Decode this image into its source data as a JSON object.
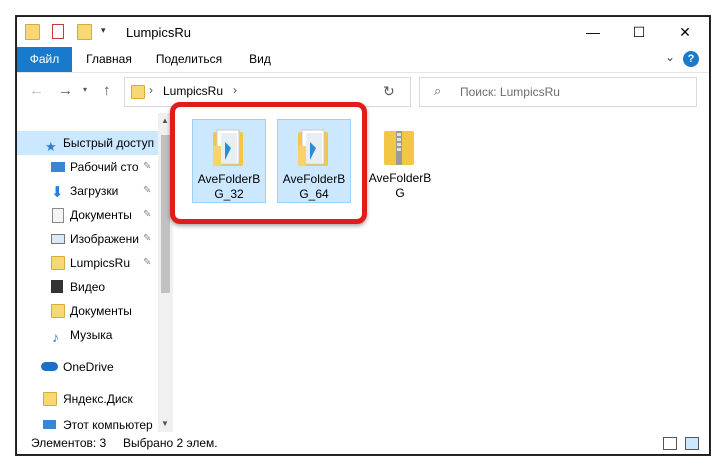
{
  "window": {
    "title": "LumpicsRu",
    "controls": {
      "minimize": "—",
      "maximize": "☐",
      "close": "✕"
    }
  },
  "ribbon": {
    "tabs": [
      "Файл",
      "Главная",
      "Поделиться",
      "Вид"
    ],
    "help": "?"
  },
  "address": {
    "path": "LumpicsRu",
    "search_placeholder": "Поиск: LumpicsRu"
  },
  "sidebar": {
    "items": [
      {
        "label": "Быстрый доступ",
        "icon": "star-icon",
        "pinned": false
      },
      {
        "label": "Рабочий сто",
        "icon": "desktop-icon",
        "pinned": true
      },
      {
        "label": "Загрузки",
        "icon": "download-icon",
        "pinned": true
      },
      {
        "label": "Документы",
        "icon": "documents-icon",
        "pinned": true
      },
      {
        "label": "Изображени",
        "icon": "pictures-icon",
        "pinned": true
      },
      {
        "label": "LumpicsRu",
        "icon": "folder-icon",
        "pinned": true
      },
      {
        "label": "Видео",
        "icon": "video-icon",
        "pinned": false
      },
      {
        "label": "Документы",
        "icon": "folder-icon",
        "pinned": false
      },
      {
        "label": "Музыка",
        "icon": "music-icon",
        "pinned": false
      },
      {
        "label": "OneDrive",
        "icon": "cloud-icon",
        "pinned": false
      },
      {
        "label": "Яндекс.Диск",
        "icon": "yandex-disk-icon",
        "pinned": false
      },
      {
        "label": "Этот компьютер",
        "icon": "computer-icon",
        "pinned": false
      }
    ],
    "pin_glyph": "📌"
  },
  "files": [
    {
      "name": "AveFolderBG_32",
      "line1": "AveFolderB",
      "line2": "G_32",
      "selected": true,
      "type": "folder"
    },
    {
      "name": "AveFolderBG_64",
      "line1": "AveFolderB",
      "line2": "G_64",
      "selected": true,
      "type": "folder"
    },
    {
      "name": "AveFolderBG",
      "line1": "AveFolderB",
      "line2": "G",
      "selected": false,
      "type": "zip"
    }
  ],
  "status": {
    "count": "Элементов: 3",
    "selected": "Выбрано 2 элем."
  },
  "colors": {
    "accent": "#1979ca",
    "selection": "#cce8ff",
    "highlight": "#e21b1b"
  }
}
